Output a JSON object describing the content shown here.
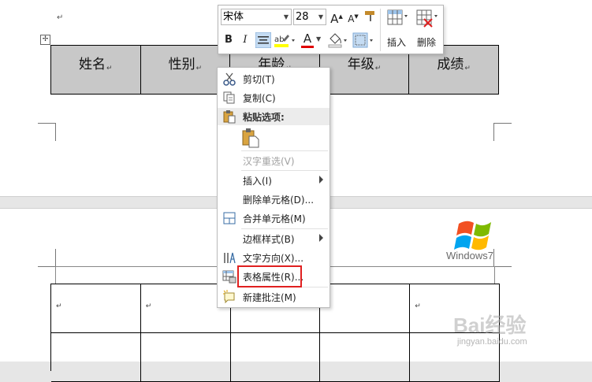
{
  "document": {
    "table_headers": [
      "姓名",
      "性别",
      "年龄",
      "年级",
      "成绩"
    ],
    "return_mark": "↵",
    "table_move_handle": "✢"
  },
  "mini_toolbar": {
    "font_name": "宋体",
    "font_size": "28",
    "buttons": {
      "bold": "B",
      "italic": "I",
      "grow_font": "A",
      "shrink_font": "A",
      "font_color": "A"
    },
    "insert_label": "插入",
    "delete_label": "删除"
  },
  "context_menu": {
    "items": [
      {
        "label": "剪切(T)",
        "icon": "scissors-icon"
      },
      {
        "label": "复制(C)",
        "icon": "copy-icon"
      },
      {
        "label": "粘贴选项:",
        "icon": "paste-icon"
      },
      {
        "label": "汉字重选(V)",
        "disabled": true
      },
      {
        "label": "插入(I)",
        "submenu": true
      },
      {
        "label": "删除单元格(D)..."
      },
      {
        "label": "合并单元格(M)",
        "icon": "merge-cells-icon"
      },
      {
        "label": "边框样式(B)",
        "submenu": true
      },
      {
        "label": "文字方向(X)...",
        "icon": "text-direction-icon"
      },
      {
        "label": "表格属性(R)...",
        "icon": "table-properties-icon"
      },
      {
        "label": "新建批注(M)",
        "icon": "new-comment-icon"
      }
    ]
  },
  "windows_logo": {
    "text": "Windows7"
  },
  "watermark": {
    "text": "Bai经验",
    "url": "jingyan.baidu.com"
  },
  "colors": {
    "highlight_box": "#e02020",
    "table_header_fill": "#c8c8c8",
    "font_color_bar": "#e00000",
    "highlighter_bar": "#ffff00"
  }
}
